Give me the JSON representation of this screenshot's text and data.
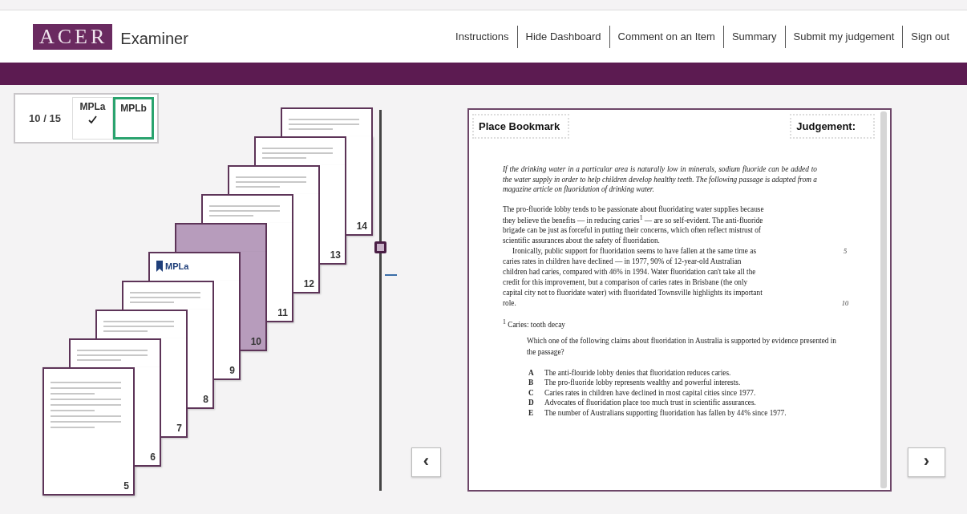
{
  "header": {
    "logo": "ACER",
    "app_name": "Examiner",
    "nav": [
      "Instructions",
      "Hide Dashboard",
      "Comment on an Item",
      "Summary",
      "Submit my judgement",
      "Sign out"
    ]
  },
  "dashboard": {
    "progress": "10 / 15",
    "versions": [
      {
        "label": "MPLa",
        "checked": true,
        "selected": false
      },
      {
        "label": "MPLb",
        "checked": false,
        "selected": true
      }
    ],
    "pages": [
      {
        "number": "5",
        "selected": false
      },
      {
        "number": "6",
        "selected": false
      },
      {
        "number": "7",
        "selected": false
      },
      {
        "number": "8",
        "selected": false
      },
      {
        "number": "9",
        "selected": false,
        "bookmark": "MPLa"
      },
      {
        "number": "10",
        "selected": true
      },
      {
        "number": "11",
        "selected": false
      },
      {
        "number": "12",
        "selected": false
      },
      {
        "number": "13",
        "selected": false
      },
      {
        "number": "14",
        "selected": false
      }
    ],
    "slider": {
      "level": 0.64
    }
  },
  "document": {
    "bookmark_button": "Place Bookmark",
    "judgement_label": "Judgement:",
    "intro": "If the drinking water in a particular area is naturally low in minerals, sodium fluoride can be added to the water supply in order to help children develop healthy teeth. The following passage is adapted from a magazine article on fluoridation of drinking water.",
    "lines": [
      {
        "text": "The pro-fluoride lobby tends to be passionate about fluoridating water supplies because",
        "indent": false
      },
      {
        "text": "they believe the benefits — in reducing caries$^{1}$ — are so self-evident. The anti-fluoride",
        "indent": false
      },
      {
        "text": "brigade can be just as forceful in putting their concerns, which often reflect mistrust of",
        "indent": false
      },
      {
        "text": "scientific assurances about the safety of fluoridation.",
        "indent": false
      },
      {
        "text": "Ironically, public support for fluoridation seems to have fallen at the same time as",
        "indent": true,
        "number": "5"
      },
      {
        "text": "caries rates in children have declined — in 1977, 90% of 12-year-old Australian",
        "indent": false
      },
      {
        "text": "children had caries, compared with 46% in 1994. Water fluoridation can't take all the",
        "indent": false
      },
      {
        "text": "credit for this improvement, but a comparison of caries rates in Brisbane (the only",
        "indent": false
      },
      {
        "text": "capital city not to fluoridate water) with fluoridated Townsville highlights its important",
        "indent": false
      },
      {
        "text": "role.",
        "indent": false,
        "number": "10"
      }
    ],
    "footnote": "$^{1}$ Caries: tooth decay",
    "question": "Which one of the following claims about fluoridation in Australia is supported by evidence presented in the passage?",
    "options": [
      {
        "letter": "A",
        "text": "The anti-flouride lobby denies that fluoridation reduces caries."
      },
      {
        "letter": "B",
        "text": "The pro-fluoride lobby represents wealthy and powerful interests."
      },
      {
        "letter": "C",
        "text": "Caries rates in children have declined in most capital cities since 1977."
      },
      {
        "letter": "D",
        "text": "Advocates of fluoridation place too much trust in scientific assurances."
      },
      {
        "letter": "E",
        "text": "The number of Australians supporting fluoridation has fallen by 44% since 1977."
      }
    ]
  },
  "navigation": {
    "previous": "‹",
    "next": "›"
  }
}
